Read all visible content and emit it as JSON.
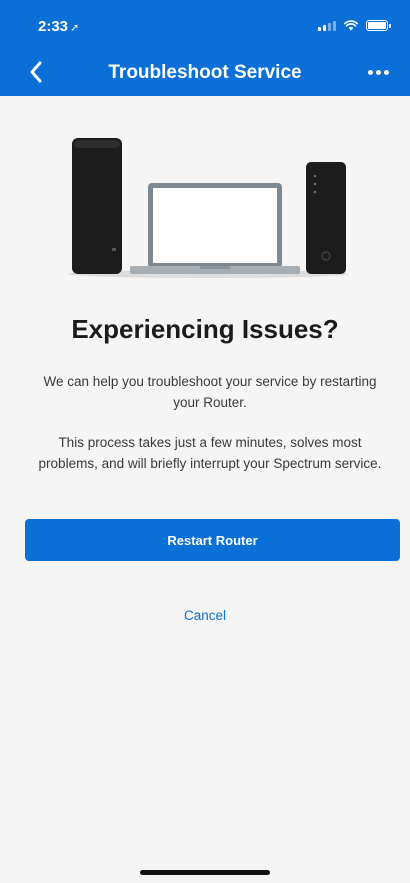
{
  "status_bar": {
    "time": "2:33",
    "location_icon": "location-arrow-icon",
    "signal_icon": "cellular-signal-icon",
    "wifi_icon": "wifi-icon",
    "battery_icon": "battery-icon"
  },
  "nav": {
    "back_icon": "chevron-left-icon",
    "title": "Troubleshoot Service",
    "more_icon": "more-horizontal-icon"
  },
  "illustration": {
    "icon": "router-laptop-modem-illustration"
  },
  "content": {
    "heading": "Experiencing Issues?",
    "paragraph_1": "We can help you troubleshoot your service by restarting your Router.",
    "paragraph_2": "This process takes just a few minutes, solves most problems, and will briefly interrupt your Spectrum service.",
    "restart_button": "Restart Router",
    "cancel_link": "Cancel"
  },
  "colors": {
    "brand_blue": "#0a6fd6",
    "background": "#f5f5f5",
    "heading_text": "#1b1b1b",
    "body_text": "#3a3a3a"
  }
}
